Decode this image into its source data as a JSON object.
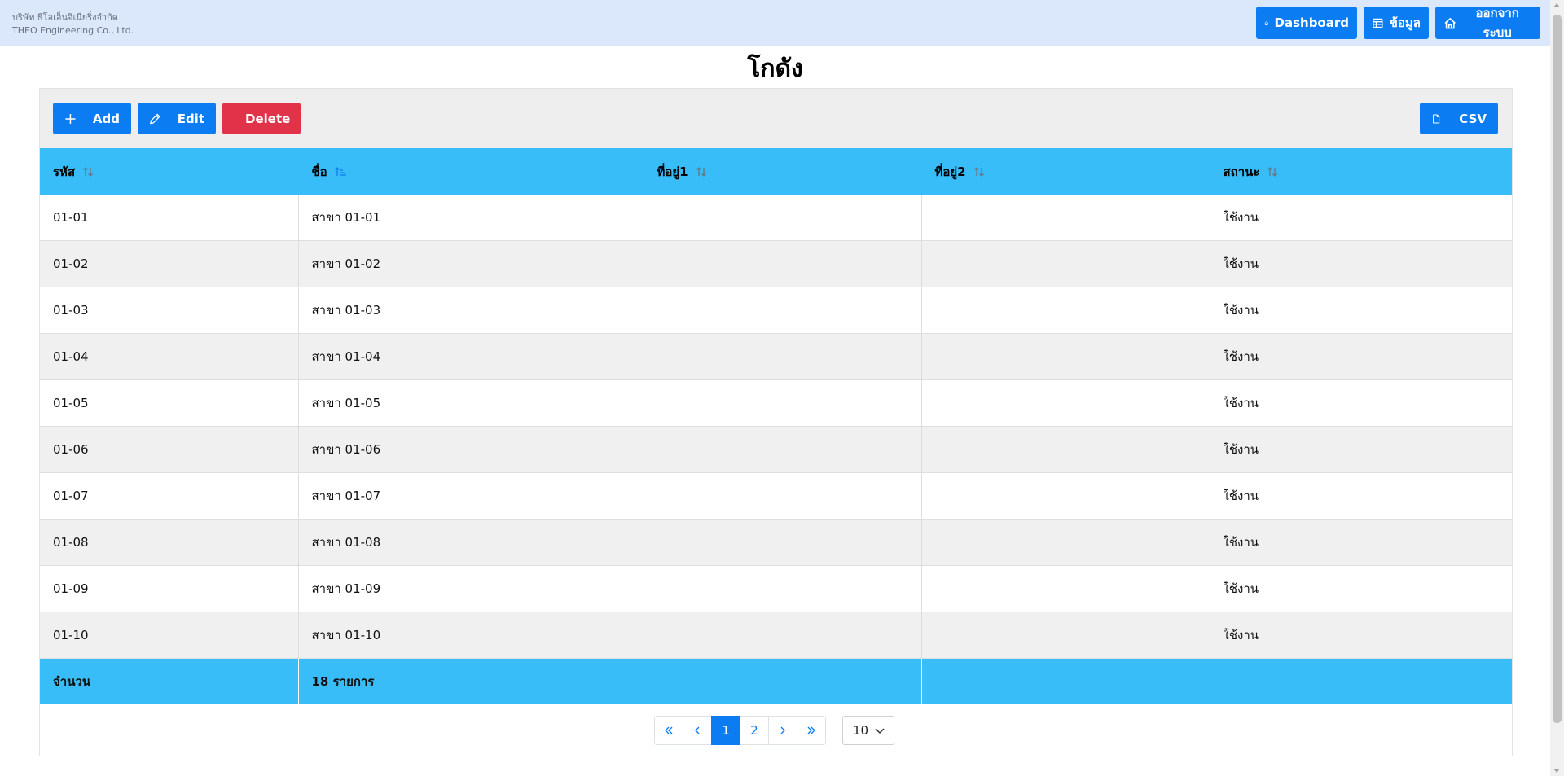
{
  "company": {
    "name_th": "บริษัท ธีโอเอ็นจิเนียริ่งจำกัด",
    "name_en": "THEO Engineering Co., Ltd."
  },
  "nav": {
    "dashboard": "Dashboard",
    "data": "ข้อมูล",
    "logout": "ออกจากระบบ"
  },
  "page": {
    "title": "โกดัง"
  },
  "toolbar": {
    "add": "Add",
    "edit": "Edit",
    "delete": "Delete",
    "csv": "CSV"
  },
  "table": {
    "columns": [
      "รหัส",
      "ชื่อ",
      "ที่อยู่1",
      "ที่อยู่2",
      "สถานะ"
    ],
    "sorted_column": "ชื่อ",
    "rows": [
      [
        "01-01",
        "สาขา 01-01",
        "",
        "",
        "ใช้งาน"
      ],
      [
        "01-02",
        "สาขา 01-02",
        "",
        "",
        "ใช้งาน"
      ],
      [
        "01-03",
        "สาขา 01-03",
        "",
        "",
        "ใช้งาน"
      ],
      [
        "01-04",
        "สาขา 01-04",
        "",
        "",
        "ใช้งาน"
      ],
      [
        "01-05",
        "สาขา 01-05",
        "",
        "",
        "ใช้งาน"
      ],
      [
        "01-06",
        "สาขา 01-06",
        "",
        "",
        "ใช้งาน"
      ],
      [
        "01-07",
        "สาขา 01-07",
        "",
        "",
        "ใช้งาน"
      ],
      [
        "01-08",
        "สาขา 01-08",
        "",
        "",
        "ใช้งาน"
      ],
      [
        "01-09",
        "สาขา 01-09",
        "",
        "",
        "ใช้งาน"
      ],
      [
        "01-10",
        "สาขา 01-10",
        "",
        "",
        "ใช้งาน"
      ]
    ],
    "footer": {
      "label": "จำนวน",
      "count": "18 รายการ"
    }
  },
  "pagination": {
    "pages": [
      "1",
      "2"
    ],
    "current": "1",
    "page_size": "10"
  },
  "colors": {
    "primary": "#0b7cf2",
    "danger": "#e0334a",
    "header": "#38bdf8",
    "topbar": "#dbe8fb"
  }
}
